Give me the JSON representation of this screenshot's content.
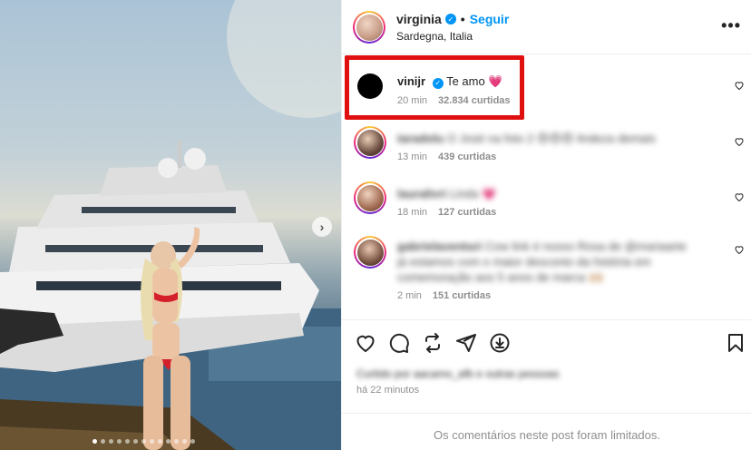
{
  "post": {
    "username": "virginia",
    "follow_label": "Seguir",
    "separator": "•",
    "location": "Sardegna, Italia",
    "more_label": "•••",
    "carousel_next": "›",
    "carousel_dots": 13,
    "carousel_active_index": 0
  },
  "comments": [
    {
      "username": "vinijr",
      "text": "Te amo",
      "emoji": "💗",
      "time": "20 min",
      "likes": "32.834 curtidas",
      "avatar": "black-circle",
      "highlighted": true,
      "blurred": false
    },
    {
      "username": "taradolu",
      "text": "O José na foto 2 😍😍😍 lindeza demais",
      "time": "13 min",
      "likes": "439 curtidas",
      "avatar": "photo",
      "highlighted": false,
      "blurred": true
    },
    {
      "username": "lauralivri",
      "text": "Linda",
      "emoji": "💗",
      "time": "18 min",
      "likes": "127 curtidas",
      "avatar": "photo",
      "highlighted": false,
      "blurred": true
    },
    {
      "username": "gabrielaventuri",
      "text": "Cow link é nosso Rosa de @mariaarte",
      "text_line2": "já estamos com o maior desconto da história em",
      "text_line3": "comemoração aos 5 anos de marca 🙌🏼",
      "time": "2 min",
      "likes": "151 curtidas",
      "avatar": "photo",
      "highlighted": false,
      "blurred": true
    }
  ],
  "actions": [
    "heart-icon",
    "comment-icon",
    "share-icon",
    "send-icon",
    "download-icon",
    "bookmark-icon"
  ],
  "liked_by": "Curtido por aacamo_afb e outras pessoas",
  "time_ago": "há 22 minutos",
  "limited_notice": "Os comentários neste post foram limitados.",
  "colors": {
    "accent": "#0095f6",
    "highlight": "#e01010",
    "muted": "#8e8e8e"
  }
}
